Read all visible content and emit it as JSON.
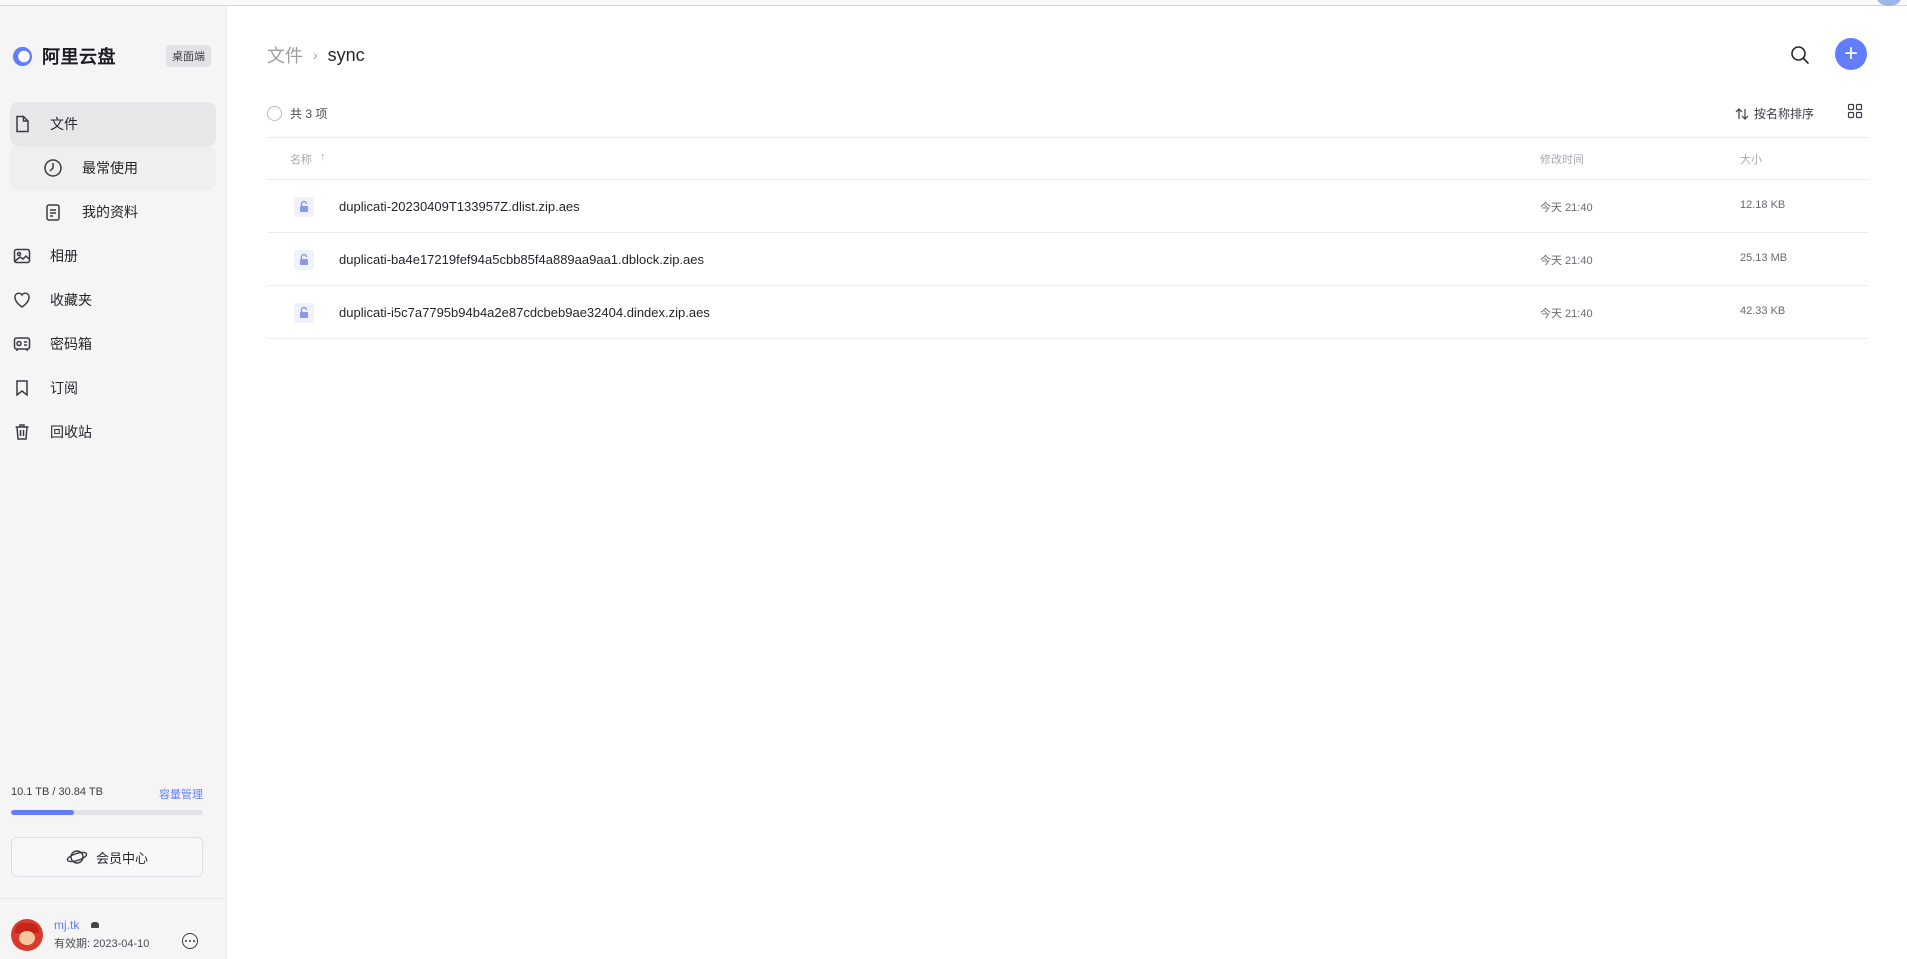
{
  "app": {
    "name": "阿里云盘",
    "desktop_badge": "桌面端"
  },
  "sidebar": {
    "items": [
      {
        "label": "文件",
        "icon": "file-icon",
        "active": true
      },
      {
        "label": "最常使用",
        "icon": "clock-icon",
        "sub": true
      },
      {
        "label": "我的资料",
        "icon": "document-icon",
        "sub": true
      },
      {
        "label": "相册",
        "icon": "photo-icon"
      },
      {
        "label": "收藏夹",
        "icon": "heart-icon"
      },
      {
        "label": "密码箱",
        "icon": "safe-icon"
      },
      {
        "label": "订阅",
        "icon": "bookmark-icon"
      },
      {
        "label": "回收站",
        "icon": "trash-icon"
      }
    ],
    "quota": {
      "text": "10.1 TB / 30.84 TB",
      "manage_label": "容量管理",
      "used_fraction": 0.3275
    },
    "vip_label": "会员中心",
    "user": {
      "name": "mj.tk",
      "expiry": "有效期: 2023-04-10"
    }
  },
  "main": {
    "breadcrumb": {
      "root": "文件",
      "separator": "›",
      "current": "sync"
    },
    "count_label": "共 3 项",
    "sort_label": "按名称排序",
    "columns": {
      "name": "名称",
      "name_sort_arrow": "↑",
      "time": "修改时间",
      "size": "大小"
    },
    "files": [
      {
        "name": "duplicati-20230409T133957Z.dlist.zip.aes",
        "time": "今天 21:40",
        "size": "12.18 KB"
      },
      {
        "name": "duplicati-ba4e17219fef94a5cbb85f4a889aa9aa1.dblock.zip.aes",
        "time": "今天 21:40",
        "size": "25.13 MB"
      },
      {
        "name": "duplicati-i5c7a7795b94b4a2e87cdcbeb9ae32404.dindex.zip.aes",
        "time": "今天 21:40",
        "size": "42.33 KB"
      }
    ]
  },
  "colors": {
    "accent": "#637dff",
    "sidebar_bg": "#f5f5f6"
  }
}
